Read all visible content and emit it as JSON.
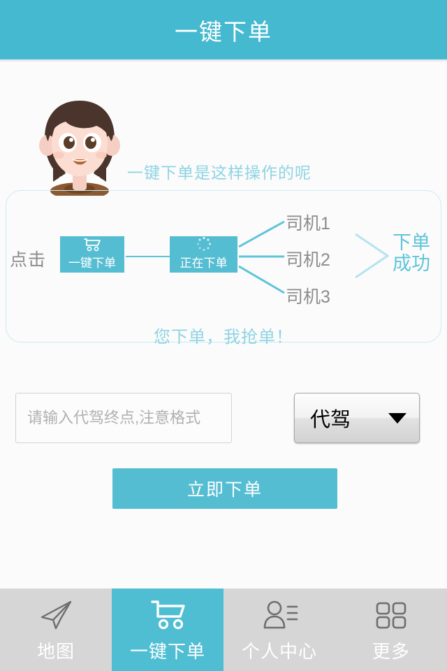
{
  "header": {
    "title": "一键下单"
  },
  "hint": {
    "text": "一键下单是这样操作的呢"
  },
  "diagram": {
    "click_label": "点击",
    "step1_label": "一键下单",
    "step1_icon": "shopping-cart-icon",
    "step2_label": "正在下单",
    "step2_icon": "loading-spinner-icon",
    "drivers": [
      "司机1",
      "司机2",
      "司机3"
    ],
    "arrow_icon": "chevron-right-icon",
    "success_line1": "下单",
    "success_line2": "成功",
    "slogan": "您下单，我抢单！",
    "line_color": "#5ec4da",
    "border_color": "#cceaf3"
  },
  "form": {
    "destination_placeholder": "请输入代驾终点,注意格式",
    "destination_value": "",
    "service_type": "代驾",
    "service_caret_icon": "chevron-down-icon",
    "submit_label": "立即下单"
  },
  "nav": {
    "items": [
      {
        "label": "地图",
        "icon": "paper-plane-icon",
        "active": false
      },
      {
        "label": "一键下单",
        "icon": "shopping-cart-icon",
        "active": true
      },
      {
        "label": "个人中心",
        "icon": "user-list-icon",
        "active": false
      },
      {
        "label": "更多",
        "icon": "grid-icon",
        "active": false
      }
    ]
  },
  "colors": {
    "accent": "#45b9cf",
    "accent_light": "#8fd4e3",
    "nav_bg": "#d6d6d6",
    "page_bg": "#fbfbfb"
  }
}
